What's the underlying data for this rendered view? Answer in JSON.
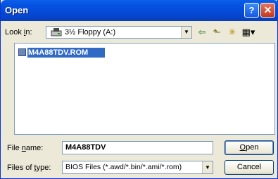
{
  "window": {
    "title": "Open",
    "help_glyph": "?",
    "close_glyph": "✕"
  },
  "lookin": {
    "label_pre": "Look ",
    "label_u": "i",
    "label_post": "n:",
    "value": "3½ Floppy (A:)",
    "icon": "floppy-drive-icon"
  },
  "toolbar": {
    "back_icon": "⇦",
    "up_icon": "⬑",
    "newfolder_icon": "✳",
    "views_icon": "▦▾"
  },
  "files": [
    {
      "name": "M4A88TDV.ROM",
      "icon": "rom-file-icon",
      "selected": true
    }
  ],
  "filename": {
    "label_pre": "File ",
    "label_u": "n",
    "label_post": "ame:",
    "value": "M4A88TDV"
  },
  "filetype": {
    "label_pre": "Files of ",
    "label_u": "t",
    "label_post": "ype:",
    "value": "BIOS Files (*.awd/*.bin/*.ami/*.rom)"
  },
  "buttons": {
    "open_u": "O",
    "open_rest": "pen",
    "cancel": "Cancel"
  },
  "colors": {
    "titlebar": "#0551e0",
    "selection": "#316ac5",
    "dialog_bg": "#ece9d8"
  }
}
